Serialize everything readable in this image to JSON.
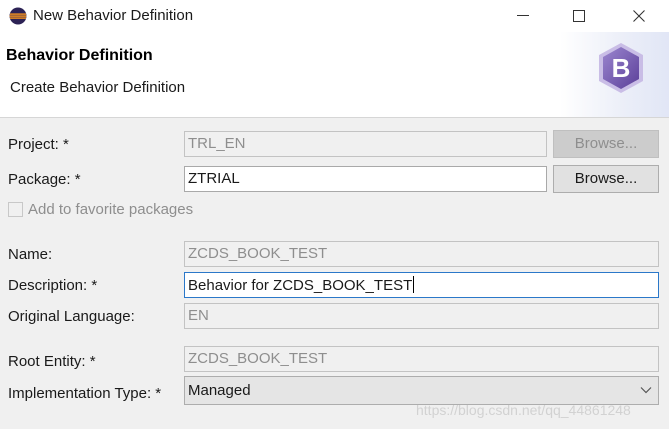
{
  "window": {
    "title": "New Behavior Definition",
    "icon": "eclipse-icon"
  },
  "banner": {
    "title": "Behavior Definition",
    "description": "Create Behavior Definition",
    "icon": "behavior-definition-icon",
    "icon_letter": "B"
  },
  "form": {
    "project": {
      "label": "Project: *",
      "value": "TRL_EN",
      "browse_label": "Browse..."
    },
    "package": {
      "label": "Package: *",
      "value": "ZTRIAL",
      "browse_label": "Browse..."
    },
    "favorites": {
      "label": "Add to favorite packages",
      "checked": false
    },
    "name": {
      "label": "Name:",
      "value": "ZCDS_BOOK_TEST"
    },
    "description": {
      "label": "Description: *",
      "value": "Behavior for ZCDS_BOOK_TEST"
    },
    "original_language": {
      "label": "Original Language:",
      "value": "EN"
    },
    "root_entity": {
      "label": "Root Entity: *",
      "value": "ZCDS_BOOK_TEST"
    },
    "implementation_type": {
      "label": "Implementation Type: *",
      "value": "Managed"
    }
  },
  "watermark": "https://blog.csdn.net/qq_44861248",
  "colors": {
    "accent": "#2b78c9",
    "icon_purple": "#6b4fa3",
    "eclipse_blue": "#2c2255",
    "eclipse_orange": "#f7941e"
  }
}
